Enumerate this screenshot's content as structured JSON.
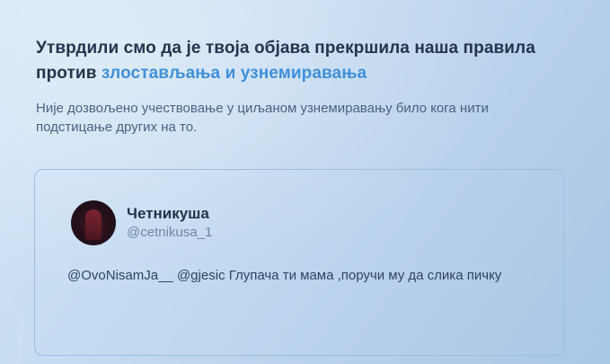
{
  "notice": {
    "heading_text": "Утврдили смо да је твоја објава прекршила наша правила против",
    "policy_link": "злостављања и узнемиравања",
    "description": "Није дозвољено учествовање у циљаном узнемиравању било кога нити подстицање других на то."
  },
  "tweet": {
    "author_name": "Четникуша",
    "author_handle": "@cetnikusa_1",
    "mention_1": "@OvoNisamJa__",
    "mention_2": "@gjesic",
    "body_text": "Глупача ти мама ,поручи му да слика пичку"
  },
  "colors": {
    "link": "#3f8fdc",
    "heading": "#23354d",
    "background": "#c6dcf2"
  }
}
